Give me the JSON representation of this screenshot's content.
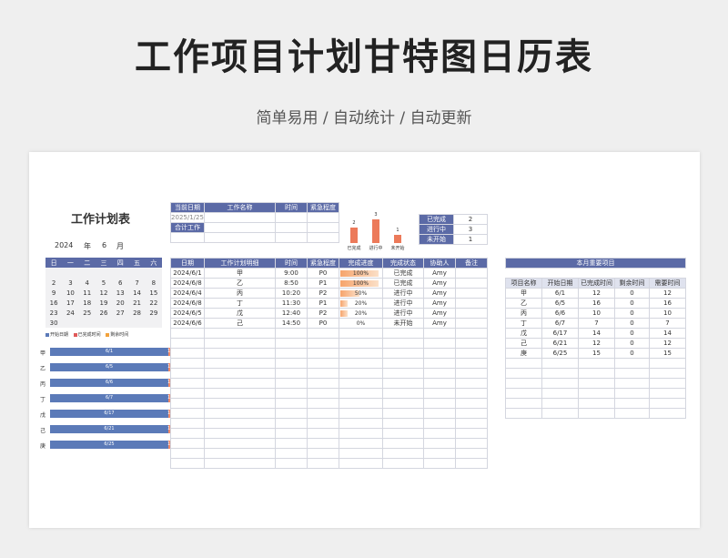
{
  "header": {
    "title": "工作项目计划甘特图日历表",
    "subtitle": "简单易用 / 自动统计 / 自动更新"
  },
  "plan_title": "工作计划表",
  "calendar": {
    "year": "2024",
    "year_unit": "年",
    "month": "6",
    "month_unit": "月",
    "weekdays": [
      "日",
      "一",
      "二",
      "三",
      "四",
      "五",
      "六"
    ],
    "weeks": [
      [
        "",
        "",
        "",
        "",
        "",
        "",
        ""
      ],
      [
        "2",
        "3",
        "4",
        "5",
        "6",
        "7",
        "8"
      ],
      [
        "9",
        "10",
        "11",
        "12",
        "13",
        "14",
        "15"
      ],
      [
        "16",
        "17",
        "18",
        "19",
        "20",
        "21",
        "22"
      ],
      [
        "23",
        "24",
        "25",
        "26",
        "27",
        "28",
        "29"
      ],
      [
        "30",
        "",
        "",
        "",
        "",
        "",
        ""
      ]
    ]
  },
  "gantt": {
    "legend": [
      "开始日期",
      "已完成时间",
      "剩余时间"
    ],
    "legend_colors": [
      "#5b7ab8",
      "#e05a5a",
      "#f2a23c"
    ],
    "rows": [
      {
        "label": "甲",
        "date": "6/1",
        "end": "1"
      },
      {
        "label": "乙",
        "date": "6/5",
        "end": "1"
      },
      {
        "label": "丙",
        "date": "6/6",
        "end": "1"
      },
      {
        "label": "丁",
        "date": "6/7",
        "end": "1"
      },
      {
        "label": "戊",
        "date": "6/17",
        "end": "1"
      },
      {
        "label": "己",
        "date": "6/21",
        "end": "1"
      },
      {
        "label": "庚",
        "date": "6/25",
        "end": "1"
      }
    ]
  },
  "info": {
    "h_current_date": "当前日期",
    "h_task_name": "工作名称",
    "h_time": "时间",
    "h_urgency": "紧急程度",
    "current_date": "2025/1/25",
    "total_label": "合计工作"
  },
  "mini_chart": {
    "bars": [
      {
        "label": "已完成",
        "value": "2",
        "v": 2
      },
      {
        "label": "进行中",
        "value": "3",
        "v": 3
      },
      {
        "label": "未开始",
        "value": "1",
        "v": 1
      }
    ]
  },
  "status_summary": [
    {
      "label": "已完成",
      "value": "2"
    },
    {
      "label": "进行中",
      "value": "3"
    },
    {
      "label": "未开始",
      "value": "1"
    }
  ],
  "main_table": {
    "headers": [
      "日期",
      "工作计划明细",
      "时间",
      "紧急程度",
      "完成进度",
      "完成状态",
      "协助人",
      "备注"
    ],
    "rows": [
      {
        "date": "2024/6/1",
        "detail": "甲",
        "time": "9:00",
        "urgency": "P0",
        "progress": "100%",
        "pct": 100,
        "status": "已完成",
        "helper": "Amy",
        "note": ""
      },
      {
        "date": "2024/6/8",
        "detail": "乙",
        "time": "8:50",
        "urgency": "P1",
        "progress": "100%",
        "pct": 100,
        "status": "已完成",
        "helper": "Amy",
        "note": ""
      },
      {
        "date": "2024/6/4",
        "detail": "丙",
        "time": "10:20",
        "urgency": "P2",
        "progress": "50%",
        "pct": 50,
        "status": "进行中",
        "helper": "Amy",
        "note": ""
      },
      {
        "date": "2024/6/8",
        "detail": "丁",
        "time": "11:30",
        "urgency": "P1",
        "progress": "20%",
        "pct": 20,
        "status": "进行中",
        "helper": "Amy",
        "note": ""
      },
      {
        "date": "2024/6/5",
        "detail": "戊",
        "time": "12:40",
        "urgency": "P2",
        "progress": "20%",
        "pct": 20,
        "status": "进行中",
        "helper": "Amy",
        "note": ""
      },
      {
        "date": "2024/6/6",
        "detail": "己",
        "time": "14:50",
        "urgency": "P0",
        "progress": "0%",
        "pct": 0,
        "status": "未开始",
        "helper": "Amy",
        "note": ""
      }
    ]
  },
  "key_projects": {
    "title": "本月重要项目",
    "headers": [
      "项目名称",
      "开始日期",
      "已完成时间",
      "剩余时间",
      "需要时间"
    ],
    "rows": [
      [
        "甲",
        "6/1",
        "12",
        "0",
        "12"
      ],
      [
        "乙",
        "6/5",
        "16",
        "0",
        "16"
      ],
      [
        "丙",
        "6/6",
        "10",
        "0",
        "10"
      ],
      [
        "丁",
        "6/7",
        "7",
        "0",
        "7"
      ],
      [
        "戊",
        "6/17",
        "14",
        "0",
        "14"
      ],
      [
        "己",
        "6/21",
        "12",
        "0",
        "12"
      ],
      [
        "庚",
        "6/25",
        "15",
        "0",
        "15"
      ]
    ]
  }
}
